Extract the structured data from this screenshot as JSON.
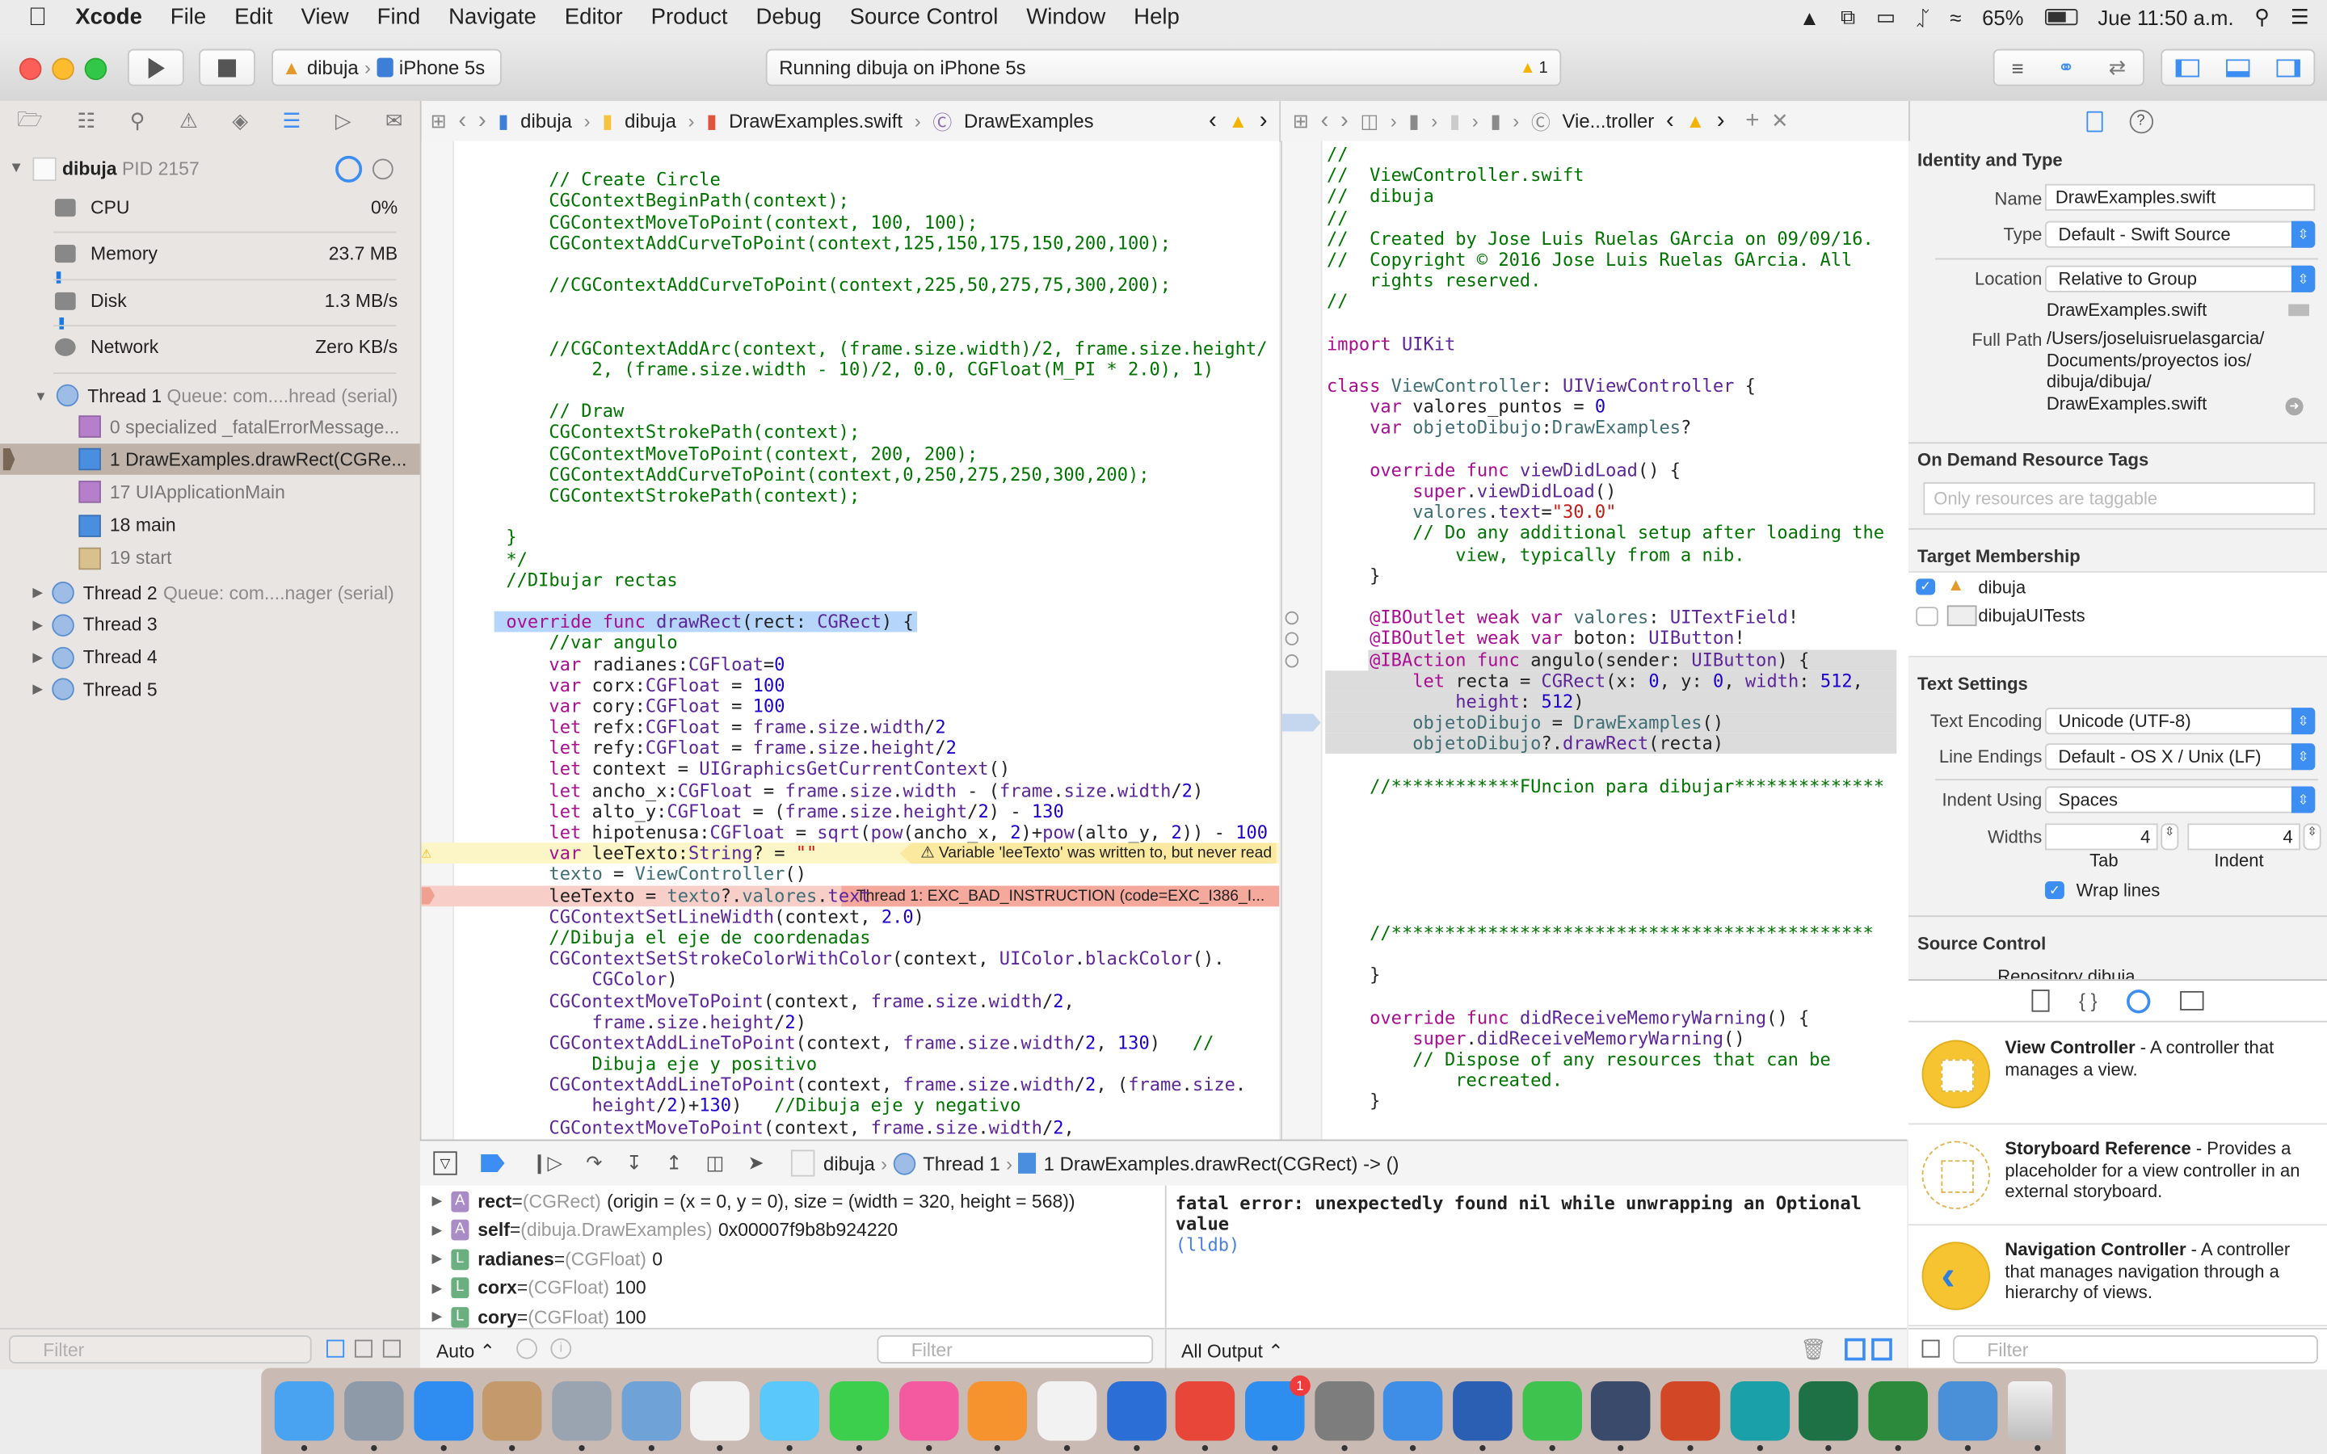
{
  "menubar": {
    "app": "Xcode",
    "items": [
      "File",
      "Edit",
      "View",
      "Find",
      "Navigate",
      "Editor",
      "Product",
      "Debug",
      "Source Control",
      "Window",
      "Help"
    ],
    "battery": "65%",
    "clock": "Jue 11:50 a.m."
  },
  "toolbar": {
    "scheme": "dibuja",
    "device": "iPhone 5s",
    "activity": "Running dibuja on iPhone 5s",
    "warning_count": "1"
  },
  "colors": {
    "accent": "#3d8ef3",
    "comment": "#007400",
    "keyword": "#aa0d91",
    "type": "#5c2699",
    "project": "#3f6e74",
    "number": "#1c00cf",
    "string": "#c41a16",
    "warning_bg": "#fcf5c6",
    "error_bg": "#f8cfc8"
  },
  "left_jumpbar": [
    "dibuja",
    "dibuja",
    "DrawExamples.swift",
    "DrawExamples"
  ],
  "right_jumpbar": {
    "current": "Vie...troller"
  },
  "navigator": {
    "process": "dibuja",
    "pid": "PID 2157",
    "gauges": [
      {
        "name": "CPU",
        "value": "0%",
        "level": 0
      },
      {
        "name": "Memory",
        "value": "23.7 MB",
        "level": 0.01
      },
      {
        "name": "Disk",
        "value": "1.3 MB/s",
        "level": 0.02
      },
      {
        "name": "Network",
        "value": "Zero KB/s",
        "level": 0
      }
    ],
    "thread1": {
      "label": "Thread 1",
      "queue": "Queue: com....hread (serial)"
    },
    "frames": [
      {
        "label": "0 specialized _fatalErrorMessage...",
        "kind": "system"
      },
      {
        "label": "1 DrawExamples.drawRect(CGRe...",
        "kind": "user",
        "selected": true
      },
      {
        "label": "17 UIApplicationMain",
        "kind": "system"
      },
      {
        "label": "18 main",
        "kind": "user"
      },
      {
        "label": "19 start",
        "kind": "system"
      }
    ],
    "threads": [
      {
        "label": "Thread 2",
        "queue": "Queue: com....nager (serial)"
      },
      {
        "label": "Thread 3",
        "queue": ""
      },
      {
        "label": "Thread 4",
        "queue": ""
      },
      {
        "label": "Thread 5",
        "queue": ""
      }
    ],
    "filter_placeholder": "Filter"
  },
  "left_code": [
    {
      "t": ""
    },
    {
      "t": "    // Create Circle",
      "k": "comment"
    },
    {
      "t": "    CGContextBeginPath(context);",
      "k": "comment"
    },
    {
      "t": "    CGContextMoveToPoint(context, 100, 100);",
      "k": "comment"
    },
    {
      "t": "    CGContextAddCurveToPoint(context,125,150,175,150,200,100);",
      "k": "comment"
    },
    {
      "t": ""
    },
    {
      "t": "    //CGContextAddCurveToPoint(context,225,50,275,75,300,200);",
      "k": "comment"
    },
    {
      "t": ""
    },
    {
      "t": ""
    },
    {
      "t": "    //CGContextAddArc(context, (frame.size.width)/2, frame.size.height/",
      "k": "comment"
    },
    {
      "t": "        2, (frame.size.width - 10)/2, 0.0, CGFloat(M_PI * 2.0), 1)",
      "k": "comment"
    },
    {
      "t": ""
    },
    {
      "t": "    // Draw",
      "k": "comment"
    },
    {
      "t": "    CGContextStrokePath(context);",
      "k": "comment"
    },
    {
      "t": "    CGContextMoveToPoint(context, 200, 200);",
      "k": "comment"
    },
    {
      "t": "    CGContextAddCurveToPoint(context,0,250,275,250,300,200);",
      "k": "comment"
    },
    {
      "t": "    CGContextStrokePath(context);",
      "k": "comment"
    },
    {
      "t": ""
    },
    {
      "t": "}",
      "k": "comment"
    },
    {
      "t": "*/",
      "k": "comment"
    },
    {
      "t": "//DIbujar rectas",
      "k": "comment"
    },
    {
      "t": ""
    },
    {
      "t": "override func drawRect(rect: CGRect) {",
      "k": "selected"
    },
    {
      "t": "    //var angulo"
    },
    {
      "t": "    var radianes:CGFloat=0"
    },
    {
      "t": "    var corx:CGFloat = 100"
    },
    {
      "t": "    var cory:CGFloat = 100"
    },
    {
      "t": "    let refx:CGFloat = frame.size.width/2"
    },
    {
      "t": "    let refy:CGFloat = frame.size.height/2"
    },
    {
      "t": "    let context = UIGraphicsGetCurrentContext()"
    },
    {
      "t": "    let ancho_x:CGFloat = frame.size.width - (frame.size.width/2)"
    },
    {
      "t": "    let alto_y:CGFloat = (frame.size.height/2) - 130"
    },
    {
      "t": "    let hipotenusa:CGFloat = sqrt(pow(ancho_x, 2)+pow(alto_y, 2)) - 100"
    },
    {
      "t": "    var leeTexto:String? = \"\"",
      "k": "warning",
      "msg": "Variable 'leeTexto' was written to, but never read"
    },
    {
      "t": "    texto = ViewController()"
    },
    {
      "t": "    leeTexto = texto?.valores.text",
      "k": "error",
      "msg": "Thread 1: EXC_BAD_INSTRUCTION (code=EXC_I386_I..."
    },
    {
      "t": "    CGContextSetLineWidth(context, 2.0)"
    },
    {
      "t": "    //Dibuja el eje de coordenadas"
    },
    {
      "t": "    CGContextSetStrokeColorWithColor(context, UIColor.blackColor()."
    },
    {
      "t": "        CGColor)"
    },
    {
      "t": "    CGContextMoveToPoint(context, frame.size.width/2,"
    },
    {
      "t": "        frame.size.height/2)"
    },
    {
      "t": "    CGContextAddLineToPoint(context, frame.size.width/2, 130)   //"
    },
    {
      "t": "        Dibuja eje y positivo",
      "k": "comment"
    },
    {
      "t": "    CGContextAddLineToPoint(context, frame.size.width/2, (frame.size."
    },
    {
      "t": "        height/2)+130)   //Dibuja eje y negativo"
    },
    {
      "t": "    CGContextMoveToPoint(context, frame.size.width/2,"
    }
  ],
  "right_code": [
    {
      "t": "//"
    },
    {
      "t": "//  ViewController.swift"
    },
    {
      "t": "//  dibuja"
    },
    {
      "t": "//"
    },
    {
      "t": "//  Created by Jose Luis Ruelas GArcia on 09/09/16."
    },
    {
      "t": "//  Copyright © 2016 Jose Luis Ruelas GArcia. All"
    },
    {
      "t": "    rights reserved.",
      "k": "comment"
    },
    {
      "t": "//"
    },
    {
      "t": ""
    },
    {
      "t": "import UIKit"
    },
    {
      "t": ""
    },
    {
      "t": "class ViewController: UIViewController {"
    },
    {
      "t": "    var valores_puntos = 0"
    },
    {
      "t": "    var objetoDibujo:DrawExamples?"
    },
    {
      "t": ""
    },
    {
      "t": "    override func viewDidLoad() {"
    },
    {
      "t": "        super.viewDidLoad()"
    },
    {
      "t": "        valores.text=\"30.0\""
    },
    {
      "t": "        // Do any additional setup after loading the"
    },
    {
      "t": "            view, typically from a nib.",
      "k": "comment"
    },
    {
      "t": "    }"
    },
    {
      "t": ""
    },
    {
      "t": "    @IBOutlet weak var valores: UITextField!",
      "k": "outlet"
    },
    {
      "t": "    @IBOutlet weak var boton: UIButton!",
      "k": "outlet"
    },
    {
      "t": "    @IBAction func angulo(sender: UIButton) {",
      "k": "action"
    },
    {
      "t": "        let recta = CGRect(x: 0, y: 0, width: 512,",
      "k": "block"
    },
    {
      "t": "            height: 512)",
      "k": "block"
    },
    {
      "t": "        objetoDibujo = DrawExamples()",
      "k": "block-pc"
    },
    {
      "t": "        objetoDibujo?.drawRect(recta)",
      "k": "block"
    },
    {
      "t": ""
    },
    {
      "t": "    //************FUncion para dibujar**************"
    },
    {
      "t": ""
    },
    {
      "t": ""
    },
    {
      "t": ""
    },
    {
      "t": ""
    },
    {
      "t": ""
    },
    {
      "t": ""
    },
    {
      "t": "    //*********************************************"
    },
    {
      "t": ""
    },
    {
      "t": "    }"
    },
    {
      "t": ""
    },
    {
      "t": "    override func didReceiveMemoryWarning() {"
    },
    {
      "t": "        super.didReceiveMemoryWarning()"
    },
    {
      "t": "        // Dispose of any resources that can be"
    },
    {
      "t": "            recreated.",
      "k": "comment"
    },
    {
      "t": "    }"
    }
  ],
  "debug_bar": {
    "process": "dibuja",
    "thread": "Thread 1",
    "frame": "1 DrawExamples.drawRect(CGRect) -> ()"
  },
  "variables": [
    {
      "badge": "A",
      "name": "rect",
      "type": "(CGRect)",
      "value": "(origin = (x = 0, y = 0), size = (width = 320, height = 568))"
    },
    {
      "badge": "A",
      "name": "self",
      "type": "(dibuja.DrawExamples)",
      "value": "0x00007f9b8b924220"
    },
    {
      "badge": "L",
      "name": "radianes",
      "type": "(CGFloat)",
      "value": "0"
    },
    {
      "badge": "L",
      "name": "corx",
      "type": "(CGFloat)",
      "value": "100"
    },
    {
      "badge": "L",
      "name": "cory",
      "type": "(CGFloat)",
      "value": "100"
    }
  ],
  "variables_footer": {
    "scope": "Auto ⌃",
    "filter_placeholder": "Filter"
  },
  "console": {
    "error": "fatal error: unexpectedly found nil while unwrapping an Optional value",
    "prompt": "(lldb)",
    "output_selector": "All Output ⌃"
  },
  "inspector": {
    "identity_title": "Identity and Type",
    "name_label": "Name",
    "name_value": "DrawExamples.swift",
    "type_label": "Type",
    "type_value": "Default - Swift Source",
    "location_label": "Location",
    "location_value": "Relative to Group",
    "location_file": "DrawExamples.swift",
    "fullpath_label": "Full Path",
    "fullpath_lines": [
      "/Users/joseluisruelasgarcia/",
      "Documents/proyectos ios/",
      "dibuja/dibuja/",
      "DrawExamples.swift"
    ],
    "odr_title": "On Demand Resource Tags",
    "odr_placeholder": "Only resources are taggable",
    "target_title": "Target Membership",
    "targets": [
      {
        "name": "dibuja",
        "checked": true
      },
      {
        "name": "dibujaUITests",
        "checked": false
      }
    ],
    "text_title": "Text Settings",
    "encoding_label": "Text Encoding",
    "encoding_value": "Unicode (UTF-8)",
    "endings_label": "Line Endings",
    "endings_value": "Default - OS X / Unix (LF)",
    "indent_label": "Indent Using",
    "indent_value": "Spaces",
    "widths_label": "Widths",
    "tab_value": "4",
    "indent_width_value": "4",
    "tab_caption": "Tab",
    "indent_caption": "Indent",
    "wrap_label": "Wrap lines",
    "wrap_checked": true,
    "sc_title": "Source Control",
    "sc_partial": "Repository  dibuja"
  },
  "library": {
    "items": [
      {
        "title": "View Controller",
        "desc": " - A controller that manages a view."
      },
      {
        "title": "Storyboard Reference",
        "desc": " - Provides a placeholder for a view controller in an external storyboard."
      },
      {
        "title": "Navigation Controller",
        "desc": " - A controller that manages navigation through a hierarchy of views."
      }
    ],
    "filter_placeholder": "Filter"
  },
  "dock": [
    {
      "icon": "finder-icon",
      "color": "#4aa3f0"
    },
    {
      "icon": "launchpad-icon",
      "color": "#8e9aa8"
    },
    {
      "icon": "safari-icon",
      "color": "#2f8df2"
    },
    {
      "icon": "contacts-icon",
      "color": "#c49a6c"
    },
    {
      "icon": "utility-icon",
      "color": "#9aa4b0"
    },
    {
      "icon": "preview-icon",
      "color": "#6fa3d8"
    },
    {
      "icon": "photos-icon",
      "color": "#f2f2f2"
    },
    {
      "icon": "messages-icon",
      "color": "#5ac8fa"
    },
    {
      "icon": "facetime-icon",
      "color": "#3ccf4e"
    },
    {
      "icon": "itunes-icon",
      "color": "#f45aa0"
    },
    {
      "icon": "ibooks-icon",
      "color": "#f7932f"
    },
    {
      "icon": "textedit-icon",
      "color": "#f2f2f2"
    },
    {
      "icon": "remote-desktop-icon",
      "color": "#2b6fd6"
    },
    {
      "icon": "chrome-icon",
      "color": "#e9463a"
    },
    {
      "icon": "app-store-icon",
      "color": "#2d8ef0",
      "badge": "1"
    },
    {
      "icon": "system-preferences-icon",
      "color": "#7d7d7d"
    },
    {
      "icon": "xcode-icon",
      "color": "#3e8ee8"
    },
    {
      "icon": "word-icon",
      "color": "#2b5fb4"
    },
    {
      "icon": "whatsapp-icon",
      "color": "#3ec34f"
    },
    {
      "icon": "mplab-x-ide-icon",
      "color": "#3a4a6a"
    },
    {
      "icon": "powerpoint-icon",
      "color": "#d24726"
    },
    {
      "icon": "arduino-icon",
      "color": "#1aa0a8"
    },
    {
      "icon": "excel-icon",
      "color": "#1e7145"
    },
    {
      "icon": "jamaica-icon",
      "color": "#2c8a3c"
    },
    {
      "icon": "simulator-icon",
      "color": "#4a90d9"
    },
    {
      "icon": "trash-icon",
      "color": "#d8d8d8"
    }
  ]
}
